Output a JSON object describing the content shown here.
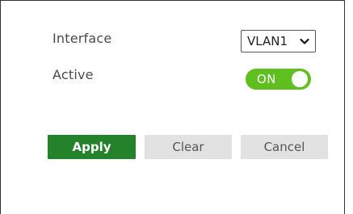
{
  "form": {
    "interface_label": "Interface",
    "active_label": "Active",
    "interface_select": {
      "value": "VLAN1",
      "arrow_icon": "chevron-down-icon"
    },
    "active_toggle": {
      "state_label": "ON",
      "on": true,
      "color": "#5fbf1f"
    }
  },
  "actions": {
    "apply_label": "Apply",
    "clear_label": "Clear",
    "cancel_label": "Cancel",
    "apply_color": "#24832a",
    "secondary_color": "#e2e2e2"
  }
}
